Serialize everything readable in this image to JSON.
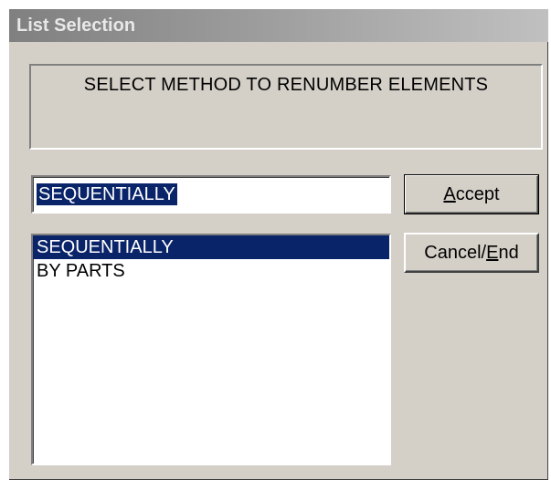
{
  "window": {
    "title": "List Selection"
  },
  "prompt": {
    "text": "SELECT METHOD TO RENUMBER ELEMENTS"
  },
  "selection_field": {
    "value": "SEQUENTIALLY"
  },
  "list": {
    "items": [
      {
        "label": "SEQUENTIALLY",
        "selected": true
      },
      {
        "label": "BY PARTS",
        "selected": false
      }
    ]
  },
  "buttons": {
    "accept": {
      "mnemonic": "A",
      "rest": "ccept"
    },
    "cancel": {
      "before": "Cancel/",
      "mnemonic": "E",
      "after": "nd"
    }
  },
  "colors": {
    "dialog_bg": "#d4d0c8",
    "selection_bg": "#0a246a",
    "selection_fg": "#ffffff",
    "titlebar_inactive": "#808080"
  }
}
